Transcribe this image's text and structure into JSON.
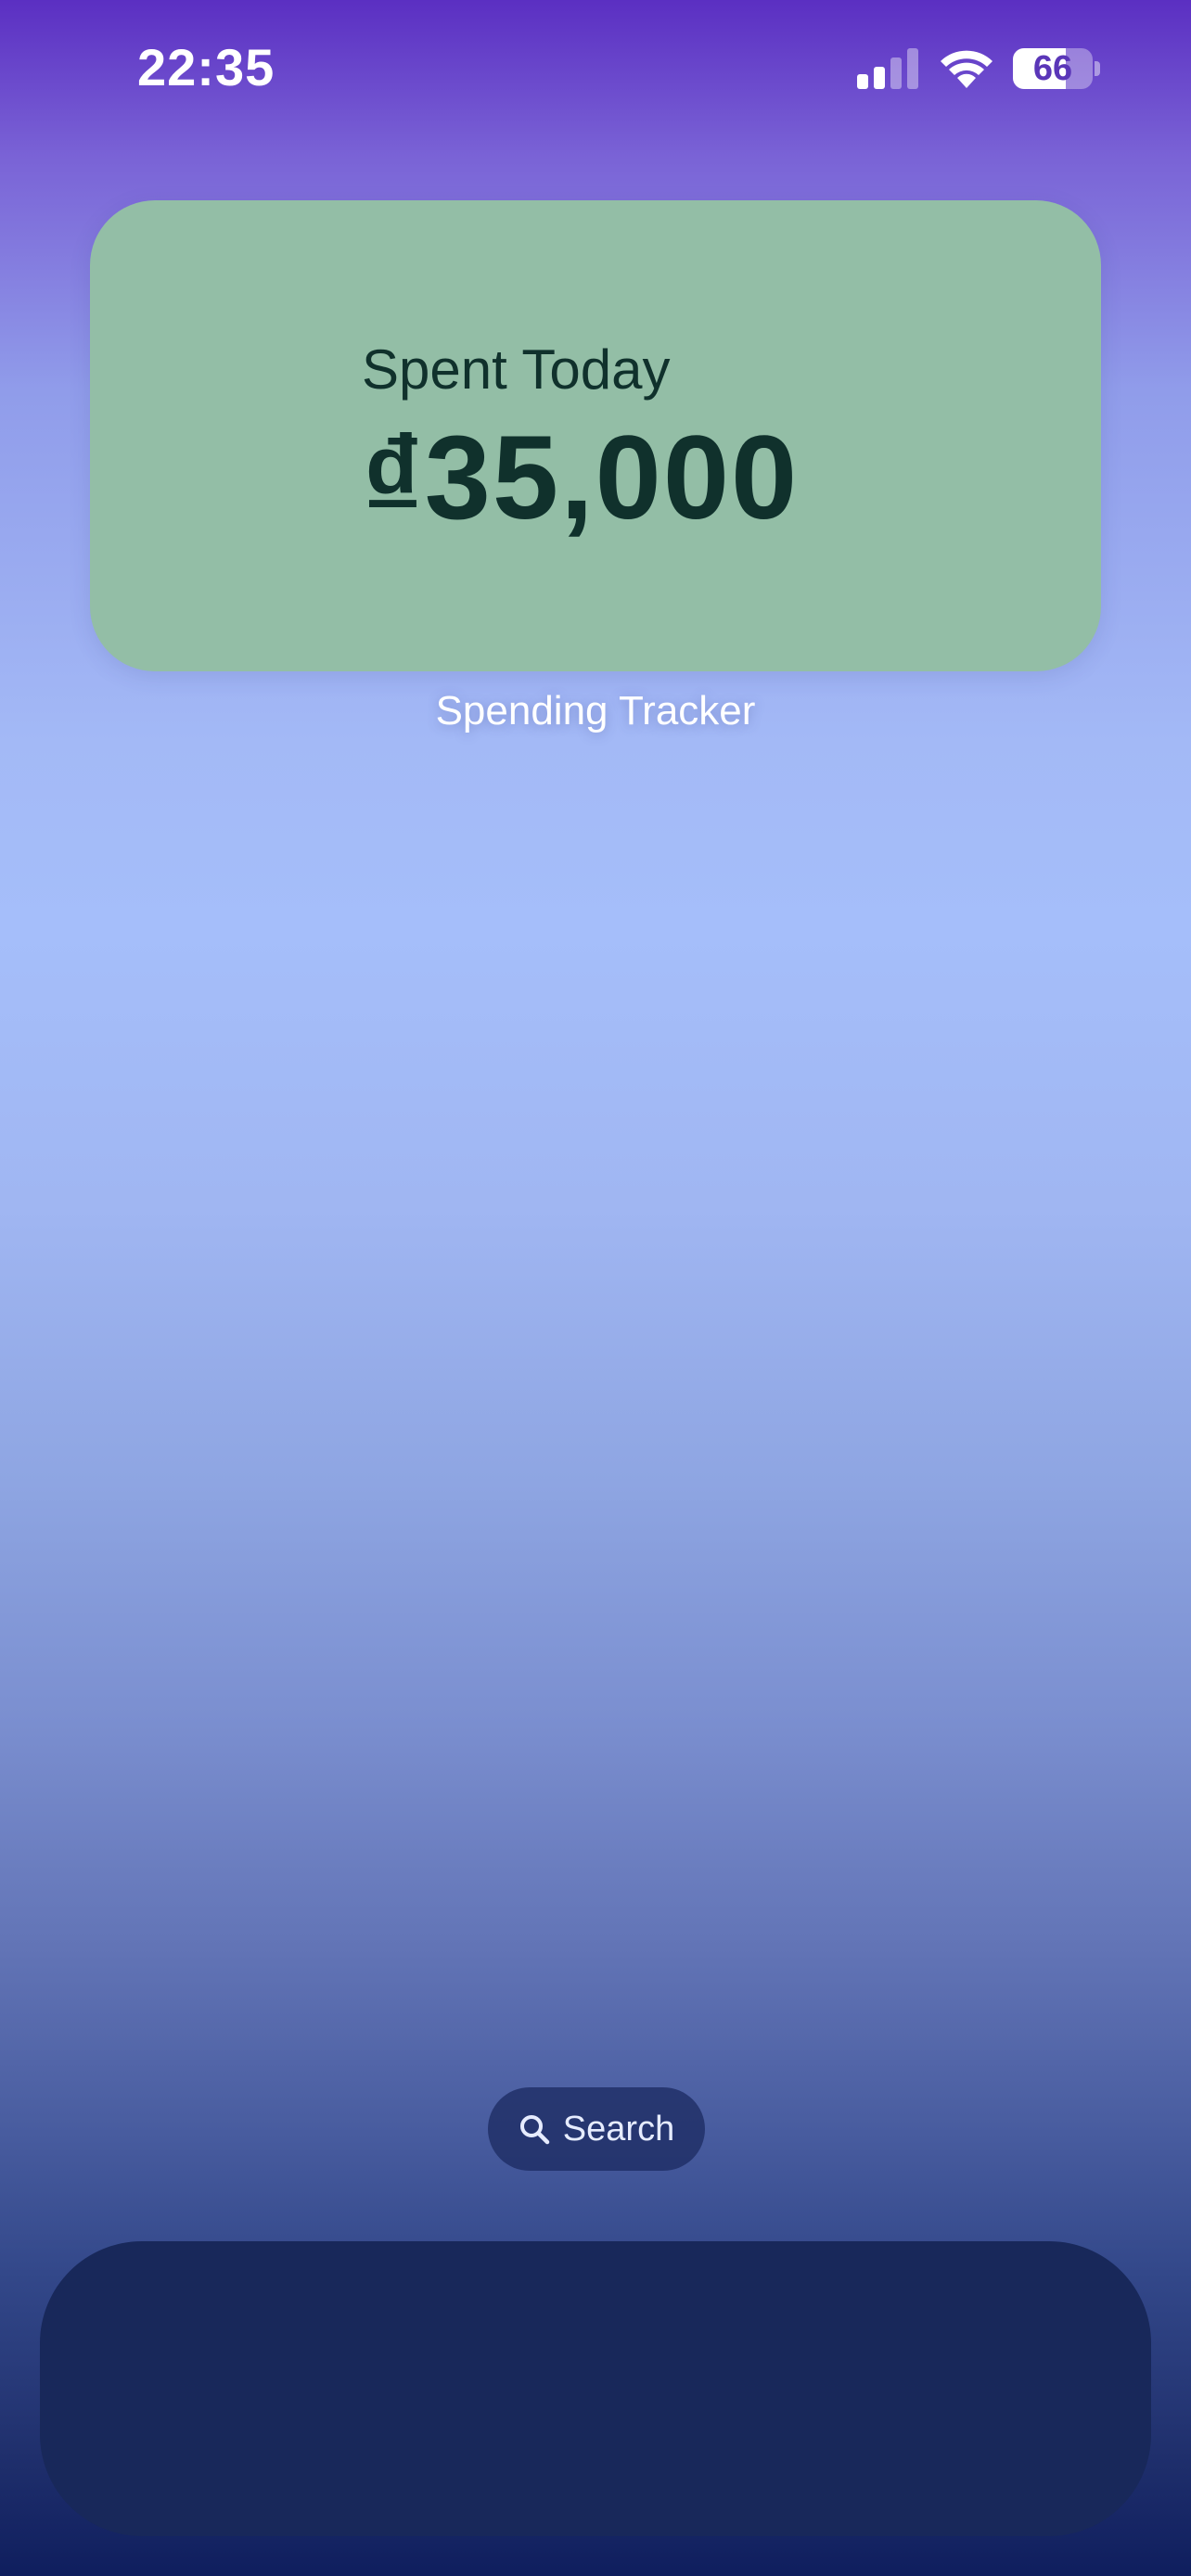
{
  "status_bar": {
    "time": "22:35",
    "battery_percent": 66,
    "battery_label": "66",
    "signal_bars_active": 2,
    "signal_bars_total": 4
  },
  "widget": {
    "label": "Spent Today",
    "amount": "₫35,000",
    "app_name": "Spending Tracker",
    "background_color": "#93bea6",
    "text_color": "#10312c"
  },
  "search": {
    "label": "Search",
    "icon": "search-icon"
  },
  "icons": {
    "signal": "cellular-signal-icon",
    "wifi": "wifi-icon",
    "battery": "battery-icon"
  }
}
